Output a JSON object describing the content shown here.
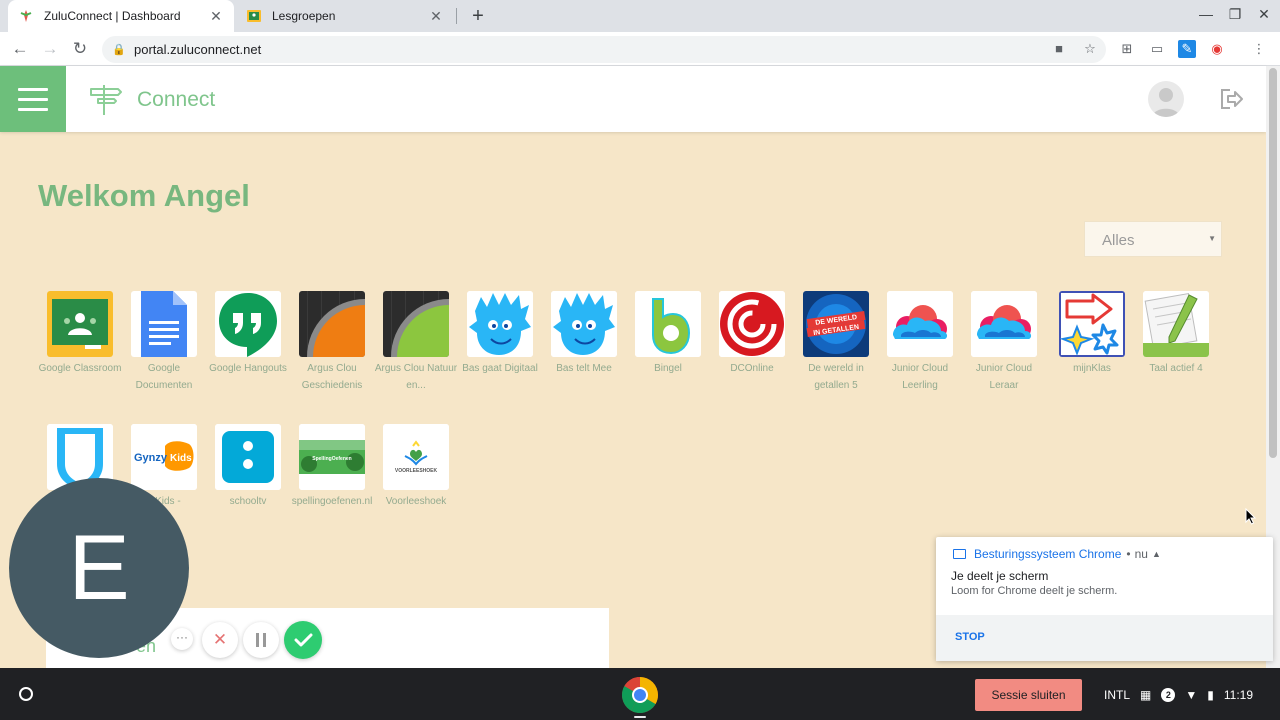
{
  "browser": {
    "tabs": [
      {
        "label": "ZuluConnect | Dashboard",
        "active": true
      },
      {
        "label": "Lesgroepen",
        "active": false
      }
    ],
    "url": "portal.zuluconnect.net"
  },
  "header": {
    "brand": "Connect"
  },
  "main": {
    "welcome": "Welkom Angel",
    "filter": {
      "selected": "Alles"
    },
    "apps": [
      {
        "label": "Google Classroom"
      },
      {
        "label": "Google Documenten"
      },
      {
        "label": "Google Hangouts"
      },
      {
        "label": "Argus Clou Geschiedenis"
      },
      {
        "label": "Argus Clou Natuur en..."
      },
      {
        "label": "Bas gaat Digitaal"
      },
      {
        "label": "Bas telt Mee"
      },
      {
        "label": "Bingel"
      },
      {
        "label": "DCOnline"
      },
      {
        "label": "De wereld in getallen 5"
      },
      {
        "label": "Junior Cloud Leerling"
      },
      {
        "label": "Junior Cloud Leraar"
      },
      {
        "label": "mijnKlas"
      },
      {
        "label": "Taal actief 4"
      },
      {
        "label": ""
      },
      {
        "label": "y Kids - "
      },
      {
        "label": "schooltv"
      },
      {
        "label": "spellingoefenen.nl"
      },
      {
        "label": "Voorleeshoek"
      }
    ],
    "panel_text": "en"
  },
  "loom": {
    "avatar_letter": "E",
    "more_icon": "···"
  },
  "notification": {
    "source": "Besturingssysteem Chrome",
    "separator": "•",
    "time": "nu",
    "title": "Je deelt je scherm",
    "message": "Loom for Chrome deelt je scherm.",
    "action": "STOP"
  },
  "shelf": {
    "session_button": "Sessie sluiten",
    "ime": "INTL",
    "notification_count": "2",
    "time": "11:19"
  },
  "colors": {
    "brand_green": "#6dbf7b",
    "page_bg": "#f6e6c8",
    "notif_blue": "#1a73e8",
    "session_red": "#f28b82"
  }
}
